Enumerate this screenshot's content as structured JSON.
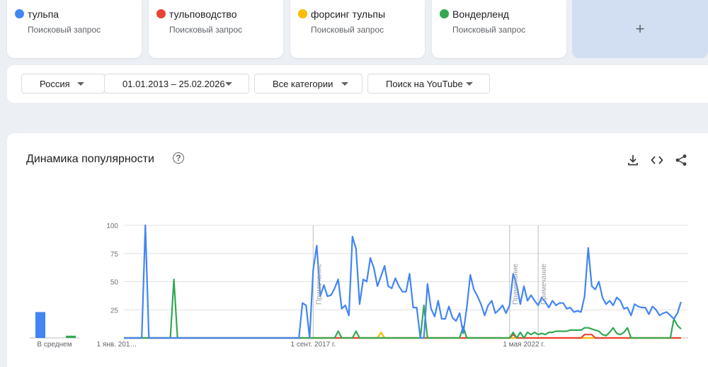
{
  "terms": [
    {
      "name": "тульпа",
      "subtitle": "Поисковый запрос",
      "color": "#4285f4"
    },
    {
      "name": "тульповодство",
      "subtitle": "Поисковый запрос",
      "color": "#ea4335"
    },
    {
      "name": "форсинг тульпы",
      "subtitle": "Поисковый запрос",
      "color": "#fbbc04"
    },
    {
      "name": "Вондерленд",
      "subtitle": "Поисковый запрос",
      "color": "#34a853"
    }
  ],
  "add_term": {
    "label": "+"
  },
  "filters": {
    "region": "Россия",
    "date_range": "01.01.2013 – 25.02.2026",
    "category": "Все категории",
    "search_type": "Поиск на YouTube"
  },
  "chart": {
    "title": "Динамика популярности",
    "help_icon": "help-circle-icon",
    "toolbar_icons": [
      "download-icon",
      "embed-code-icon",
      "share-icon"
    ]
  },
  "chart_data": {
    "type": "line",
    "ylim": [
      0,
      100
    ],
    "y_ticks": [
      100,
      75,
      50,
      25
    ],
    "x_tick_labels": [
      "1 янв. 201…",
      "1 сент. 2017 г.",
      "1 мая 2022 г."
    ],
    "annotation_label": "Примечание",
    "average_label": "В среднем",
    "averages": [
      {
        "name": "тульпа",
        "value": 23
      },
      {
        "name": "тульповодство",
        "value": 0
      },
      {
        "name": "форсинг тульпы",
        "value": 0
      },
      {
        "name": "Вондерленд",
        "value": 2
      }
    ],
    "x_range": [
      0,
      158
    ],
    "note_positions": [
      53,
      108,
      116
    ],
    "series": [
      {
        "name": "тульпа",
        "color": "#4285f4",
        "points": [
          [
            0,
            0
          ],
          [
            5,
            0
          ],
          [
            6,
            100
          ],
          [
            7,
            0
          ],
          [
            49,
            0
          ],
          [
            50,
            31
          ],
          [
            51,
            29
          ],
          [
            52,
            0
          ],
          [
            53,
            60
          ],
          [
            54,
            82
          ],
          [
            55,
            37
          ],
          [
            56,
            47
          ],
          [
            57,
            37
          ],
          [
            58,
            38
          ],
          [
            59,
            44
          ],
          [
            60,
            52
          ],
          [
            61,
            26
          ],
          [
            62,
            29
          ],
          [
            63,
            20
          ],
          [
            64,
            90
          ],
          [
            65,
            79
          ],
          [
            66,
            30
          ],
          [
            67,
            52
          ],
          [
            68,
            50
          ],
          [
            69,
            71
          ],
          [
            70,
            62
          ],
          [
            71,
            46
          ],
          [
            72,
            55
          ],
          [
            73,
            64
          ],
          [
            74,
            46
          ],
          [
            75,
            44
          ],
          [
            76,
            53
          ],
          [
            77,
            46
          ],
          [
            78,
            41
          ],
          [
            79,
            41
          ],
          [
            80,
            57
          ],
          [
            81,
            27
          ],
          [
            82,
            27
          ],
          [
            83,
            0
          ],
          [
            84,
            0
          ],
          [
            85,
            48
          ],
          [
            86,
            26
          ],
          [
            87,
            19
          ],
          [
            88,
            33
          ],
          [
            89,
            17
          ],
          [
            90,
            17
          ],
          [
            91,
            28
          ],
          [
            92,
            18
          ],
          [
            93,
            15
          ],
          [
            94,
            22
          ],
          [
            95,
            4
          ],
          [
            96,
            27
          ],
          [
            97,
            56
          ],
          [
            98,
            43
          ],
          [
            99,
            37
          ],
          [
            100,
            30
          ],
          [
            101,
            20
          ],
          [
            102,
            29
          ],
          [
            103,
            33
          ],
          [
            104,
            22
          ],
          [
            105,
            25
          ],
          [
            106,
            29
          ],
          [
            107,
            22
          ],
          [
            108,
            29
          ],
          [
            109,
            57
          ],
          [
            110,
            47
          ],
          [
            111,
            30
          ],
          [
            112,
            46
          ],
          [
            113,
            33
          ],
          [
            114,
            38
          ],
          [
            115,
            33
          ],
          [
            116,
            29
          ],
          [
            117,
            36
          ],
          [
            118,
            32
          ],
          [
            119,
            27
          ],
          [
            120,
            33
          ],
          [
            121,
            29
          ],
          [
            122,
            31
          ],
          [
            123,
            31
          ],
          [
            124,
            26
          ],
          [
            125,
            27
          ],
          [
            126,
            23
          ],
          [
            127,
            24
          ],
          [
            128,
            23
          ],
          [
            129,
            37
          ],
          [
            130,
            80
          ],
          [
            131,
            46
          ],
          [
            132,
            43
          ],
          [
            133,
            50
          ],
          [
            134,
            36
          ],
          [
            135,
            30
          ],
          [
            136,
            33
          ],
          [
            137,
            29
          ],
          [
            138,
            36
          ],
          [
            139,
            33
          ],
          [
            140,
            26
          ],
          [
            141,
            27
          ],
          [
            142,
            20
          ],
          [
            143,
            30
          ],
          [
            144,
            28
          ],
          [
            145,
            27
          ],
          [
            146,
            27
          ],
          [
            147,
            21
          ],
          [
            148,
            28
          ],
          [
            149,
            25
          ],
          [
            150,
            20
          ],
          [
            151,
            22
          ],
          [
            152,
            23
          ],
          [
            153,
            20
          ],
          [
            154,
            17
          ],
          [
            155,
            22
          ],
          [
            156,
            32
          ]
        ]
      },
      {
        "name": "тульповодство",
        "color": "#ea4335",
        "points": [
          [
            0,
            0
          ],
          [
            108,
            0
          ],
          [
            109,
            3
          ],
          [
            110,
            0
          ],
          [
            128,
            0
          ],
          [
            129,
            3
          ],
          [
            130,
            3
          ],
          [
            131,
            3
          ],
          [
            132,
            0
          ],
          [
            156,
            0
          ]
        ]
      },
      {
        "name": "форсинг тульпы",
        "color": "#fbbc04",
        "points": [
          [
            0,
            0
          ],
          [
            71,
            0
          ],
          [
            72,
            5
          ],
          [
            73,
            0
          ],
          [
            156,
            0
          ]
        ]
      },
      {
        "name": "Вондерленд",
        "color": "#34a853",
        "points": [
          [
            0,
            0
          ],
          [
            13,
            0
          ],
          [
            14,
            52
          ],
          [
            15,
            0
          ],
          [
            59,
            0
          ],
          [
            60,
            6
          ],
          [
            61,
            0
          ],
          [
            64,
            0
          ],
          [
            65,
            6
          ],
          [
            66,
            0
          ],
          [
            83,
            0
          ],
          [
            84,
            29
          ],
          [
            85,
            0
          ],
          [
            94,
            0
          ],
          [
            95,
            10
          ],
          [
            96,
            0
          ],
          [
            108,
            0
          ],
          [
            109,
            5
          ],
          [
            110,
            0
          ],
          [
            111,
            5
          ],
          [
            112,
            0
          ],
          [
            113,
            5
          ],
          [
            114,
            3
          ],
          [
            115,
            5
          ],
          [
            116,
            3
          ],
          [
            117,
            4
          ],
          [
            118,
            3
          ],
          [
            119,
            5
          ],
          [
            120,
            5
          ],
          [
            121,
            6
          ],
          [
            122,
            6
          ],
          [
            123,
            6
          ],
          [
            124,
            6
          ],
          [
            125,
            7
          ],
          [
            126,
            7
          ],
          [
            127,
            7
          ],
          [
            128,
            7
          ],
          [
            129,
            9
          ],
          [
            130,
            9
          ],
          [
            131,
            8
          ],
          [
            132,
            7
          ],
          [
            133,
            6
          ],
          [
            134,
            3
          ],
          [
            135,
            2
          ],
          [
            136,
            5
          ],
          [
            137,
            9
          ],
          [
            138,
            4
          ],
          [
            139,
            3
          ],
          [
            140,
            5
          ],
          [
            141,
            9
          ],
          [
            142,
            0
          ],
          [
            145,
            0
          ],
          [
            146,
            0
          ],
          [
            150,
            0
          ],
          [
            151,
            0
          ],
          [
            153,
            0
          ],
          [
            154,
            17
          ],
          [
            155,
            11
          ],
          [
            156,
            8
          ]
        ]
      }
    ]
  }
}
